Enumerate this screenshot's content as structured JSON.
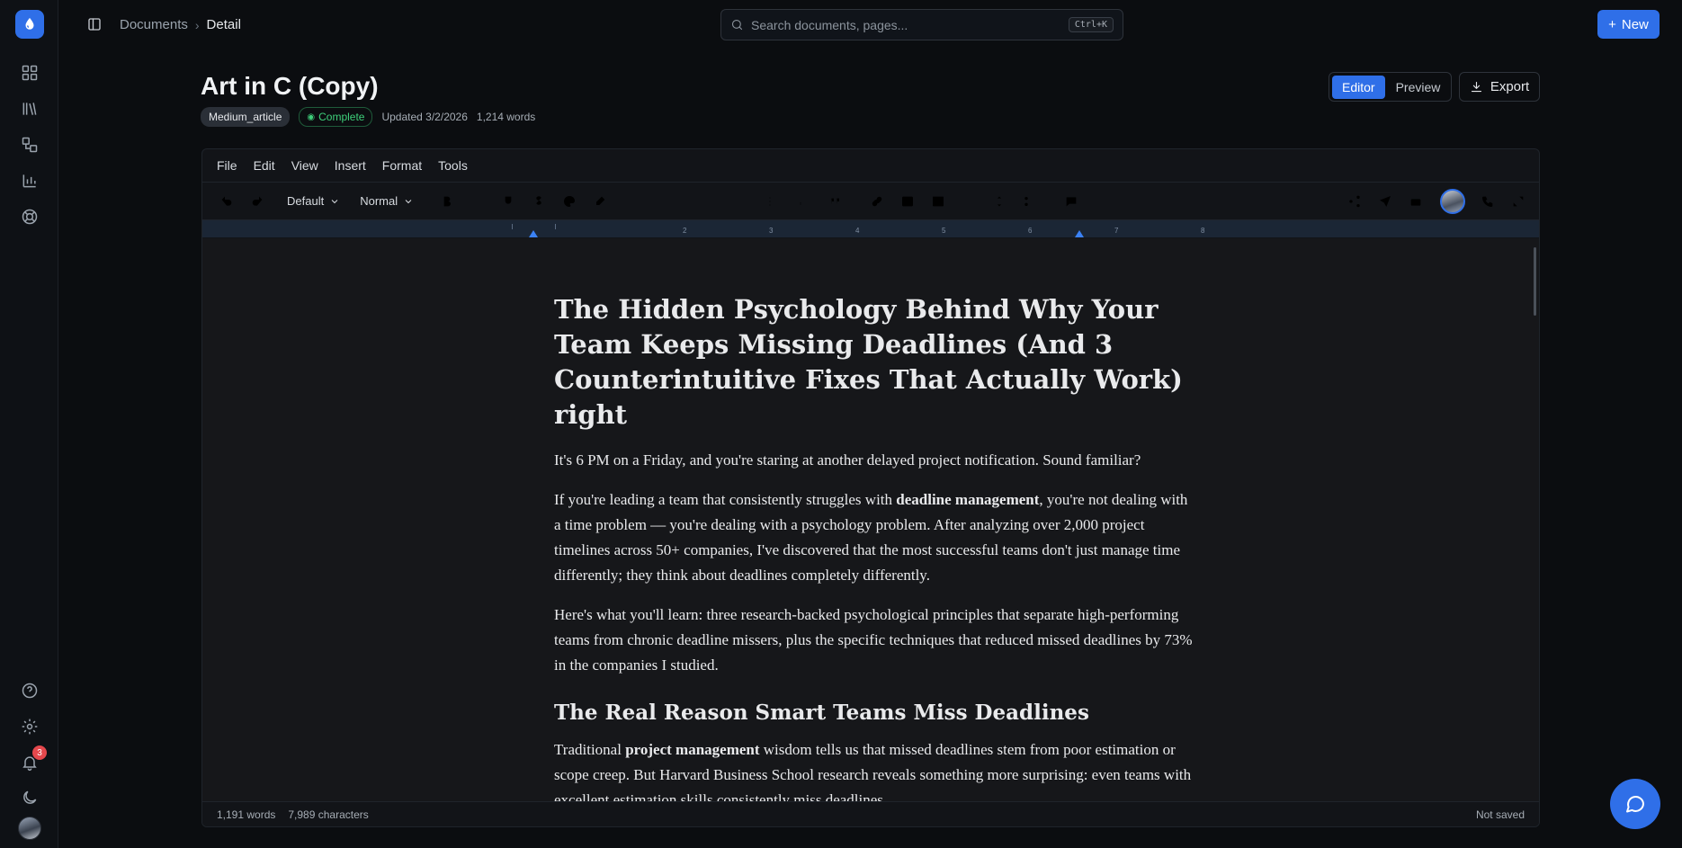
{
  "breadcrumb": {
    "root": "Documents",
    "current": "Detail"
  },
  "search": {
    "placeholder": "Search documents, pages...",
    "shortcut": "Ctrl+K"
  },
  "new_button": {
    "label": "New"
  },
  "document": {
    "title": "Art in C (Copy)",
    "type_chip": "Medium_article",
    "status": "Complete",
    "updated": "Updated 3/2/2026",
    "words": "1,214 words"
  },
  "view_toggle": {
    "editor": "Editor",
    "preview": "Preview",
    "active": "Editor"
  },
  "export_button": {
    "label": "Export"
  },
  "menu": [
    "File",
    "Edit",
    "View",
    "Insert",
    "Format",
    "Tools"
  ],
  "toolbar": {
    "font": "Default",
    "style": "Normal"
  },
  "ruler_numbers": [
    "1",
    "2",
    "3",
    "4",
    "5",
    "6",
    "7",
    "8"
  ],
  "article": {
    "heading": "The Hidden Psychology Behind Why Your Team Keeps Missing Deadlines (And 3 Counterintuitive Fixes That Actually Work) right",
    "p1": "It's 6 PM on a Friday, and you're staring at another delayed project notification. Sound familiar?",
    "p2_before": "If you're leading a team that consistently struggles with ",
    "p2_bold": "deadline management",
    "p2_after": ", you're not dealing with a time problem — you're dealing with a psychology problem. After analyzing over 2,000 project timelines across 50+ companies, I've discovered that the most successful teams don't just manage time differently; they think about deadlines completely differently.",
    "p3": "Here's what you'll learn: three research-backed psychological principles that separate high-performing teams from chronic deadline missers, plus the specific techniques that reduced missed deadlines by 73% in the companies I studied.",
    "h2": "The Real Reason Smart Teams Miss Deadlines",
    "p4_before": "Traditional ",
    "p4_bold": "project management",
    "p4_after": " wisdom tells us that missed deadlines stem from poor estimation or scope creep. But Harvard Business School research reveals something more surprising: even teams with excellent estimation skills consistently miss deadlines."
  },
  "status_bar": {
    "words": "1,191 words",
    "characters": "7,989 characters",
    "save_state": "Not saved"
  },
  "notifications": {
    "count": "3"
  },
  "colors": {
    "accent": "#2f6fe8",
    "success": "#3ecf7a",
    "badge": "#e5484d",
    "background": "#0b0d10"
  }
}
